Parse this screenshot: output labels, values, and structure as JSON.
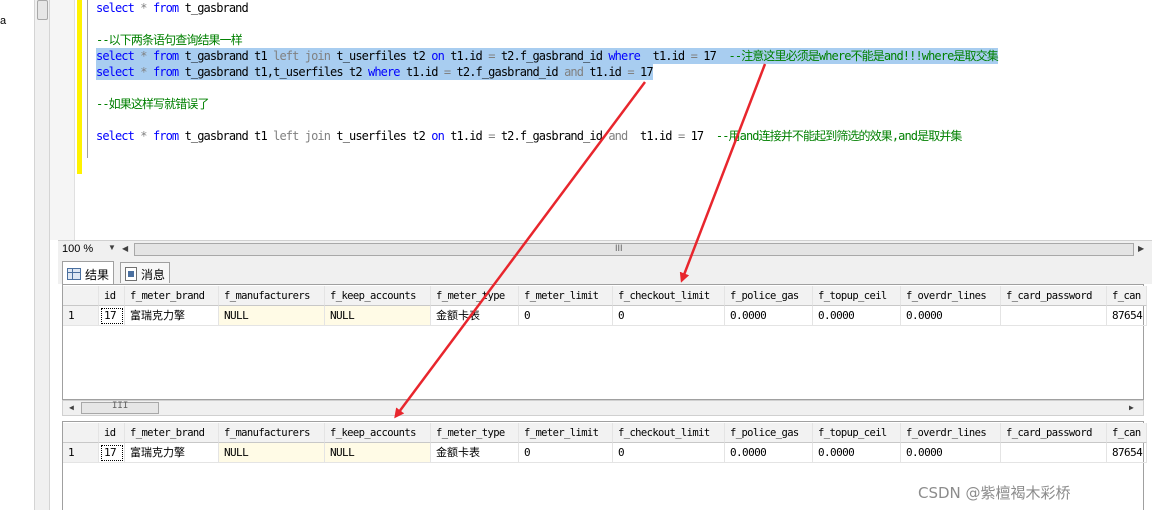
{
  "left_fragment": "a",
  "editor": {
    "lines": [
      [
        {
          "t": "select",
          "c": "kw"
        },
        {
          "t": " ",
          "c": "tx"
        },
        {
          "t": "*",
          "c": "op"
        },
        {
          "t": " ",
          "c": "tx"
        },
        {
          "t": "from",
          "c": "kw"
        },
        {
          "t": " t_gasbrand",
          "c": "tx"
        }
      ],
      [],
      [
        {
          "t": "--以下两条语句查询结果一样",
          "c": "cm"
        }
      ],
      [
        {
          "t": "select",
          "c": "kw"
        },
        {
          "t": " ",
          "c": "tx"
        },
        {
          "t": "*",
          "c": "op"
        },
        {
          "t": " ",
          "c": "tx"
        },
        {
          "t": "from",
          "c": "kw"
        },
        {
          "t": " t_gasbrand t1 ",
          "c": "tx"
        },
        {
          "t": "left join",
          "c": "op"
        },
        {
          "t": " t_userfiles t2 ",
          "c": "tx"
        },
        {
          "t": "on",
          "c": "kw"
        },
        {
          "t": " t1.id ",
          "c": "tx"
        },
        {
          "t": "=",
          "c": "op"
        },
        {
          "t": " t2.f_gasbrand_id ",
          "c": "tx"
        },
        {
          "t": "where",
          "c": "kw"
        },
        {
          "t": "  t1.id ",
          "c": "tx"
        },
        {
          "t": "=",
          "c": "op"
        },
        {
          "t": " 17  ",
          "c": "tx"
        },
        {
          "t": "--注意这里必须是where不能是and!!!where是取交集",
          "c": "cm"
        }
      ],
      [
        {
          "t": "select",
          "c": "kw"
        },
        {
          "t": " ",
          "c": "tx"
        },
        {
          "t": "*",
          "c": "op"
        },
        {
          "t": " ",
          "c": "tx"
        },
        {
          "t": "from",
          "c": "kw"
        },
        {
          "t": " t_gasbrand t1,t_userfiles t2 ",
          "c": "tx"
        },
        {
          "t": "where",
          "c": "kw"
        },
        {
          "t": " t1.id ",
          "c": "tx"
        },
        {
          "t": "=",
          "c": "op"
        },
        {
          "t": " t2.f_gasbrand_id ",
          "c": "tx"
        },
        {
          "t": "and",
          "c": "op"
        },
        {
          "t": " t1.id ",
          "c": "tx"
        },
        {
          "t": "=",
          "c": "op"
        },
        {
          "t": " 17",
          "c": "tx"
        }
      ],
      [],
      [
        {
          "t": "--如果这样写就错误了",
          "c": "cm"
        }
      ],
      [],
      [
        {
          "t": "select",
          "c": "kw"
        },
        {
          "t": " ",
          "c": "tx"
        },
        {
          "t": "*",
          "c": "op"
        },
        {
          "t": " ",
          "c": "tx"
        },
        {
          "t": "from",
          "c": "kw"
        },
        {
          "t": " t_gasbrand t1 ",
          "c": "tx"
        },
        {
          "t": "left join",
          "c": "op"
        },
        {
          "t": " t_userfiles t2 ",
          "c": "tx"
        },
        {
          "t": "on",
          "c": "kw"
        },
        {
          "t": " t1.id ",
          "c": "tx"
        },
        {
          "t": "=",
          "c": "op"
        },
        {
          "t": " t2.f_gasbrand_id ",
          "c": "tx"
        },
        {
          "t": "and",
          "c": "op"
        },
        {
          "t": "  t1.id ",
          "c": "tx"
        },
        {
          "t": "=",
          "c": "op"
        },
        {
          "t": " 17  ",
          "c": "tx"
        },
        {
          "t": "--用and连接并不能起到筛选的效果,and是取并集",
          "c": "cm"
        }
      ]
    ],
    "selected_lines": [
      3,
      4
    ]
  },
  "zoom": {
    "value": "100 %",
    "grip": "III"
  },
  "result_tabs": {
    "results": "结果",
    "messages": "消息"
  },
  "grid": {
    "columns": [
      "",
      "id",
      "f_meter_brand",
      "f_manufacturers",
      "f_keep_accounts",
      "f_meter_type",
      "f_meter_limit",
      "f_checkout_limit",
      "f_police_gas",
      "f_topup_ceil",
      "f_overdr_lines",
      "f_card_password",
      "f_can"
    ],
    "row": [
      "1",
      "17",
      "富瑞克力擎",
      "NULL",
      "NULL",
      "金额卡表",
      "0",
      "0",
      "0.0000",
      "0.0000",
      "0.0000",
      "",
      "87654"
    ]
  },
  "hscroll_grip": "III",
  "colors": {
    "keyword": "#0000ff",
    "operator": "#808080",
    "comment": "#008000",
    "selection": "#a8cdf0",
    "change_bar": "#fff200",
    "arrow": "#e8262d",
    "null_cell": "#fffbe6"
  },
  "watermark": "CSDN @紫檀褐木彩桥"
}
